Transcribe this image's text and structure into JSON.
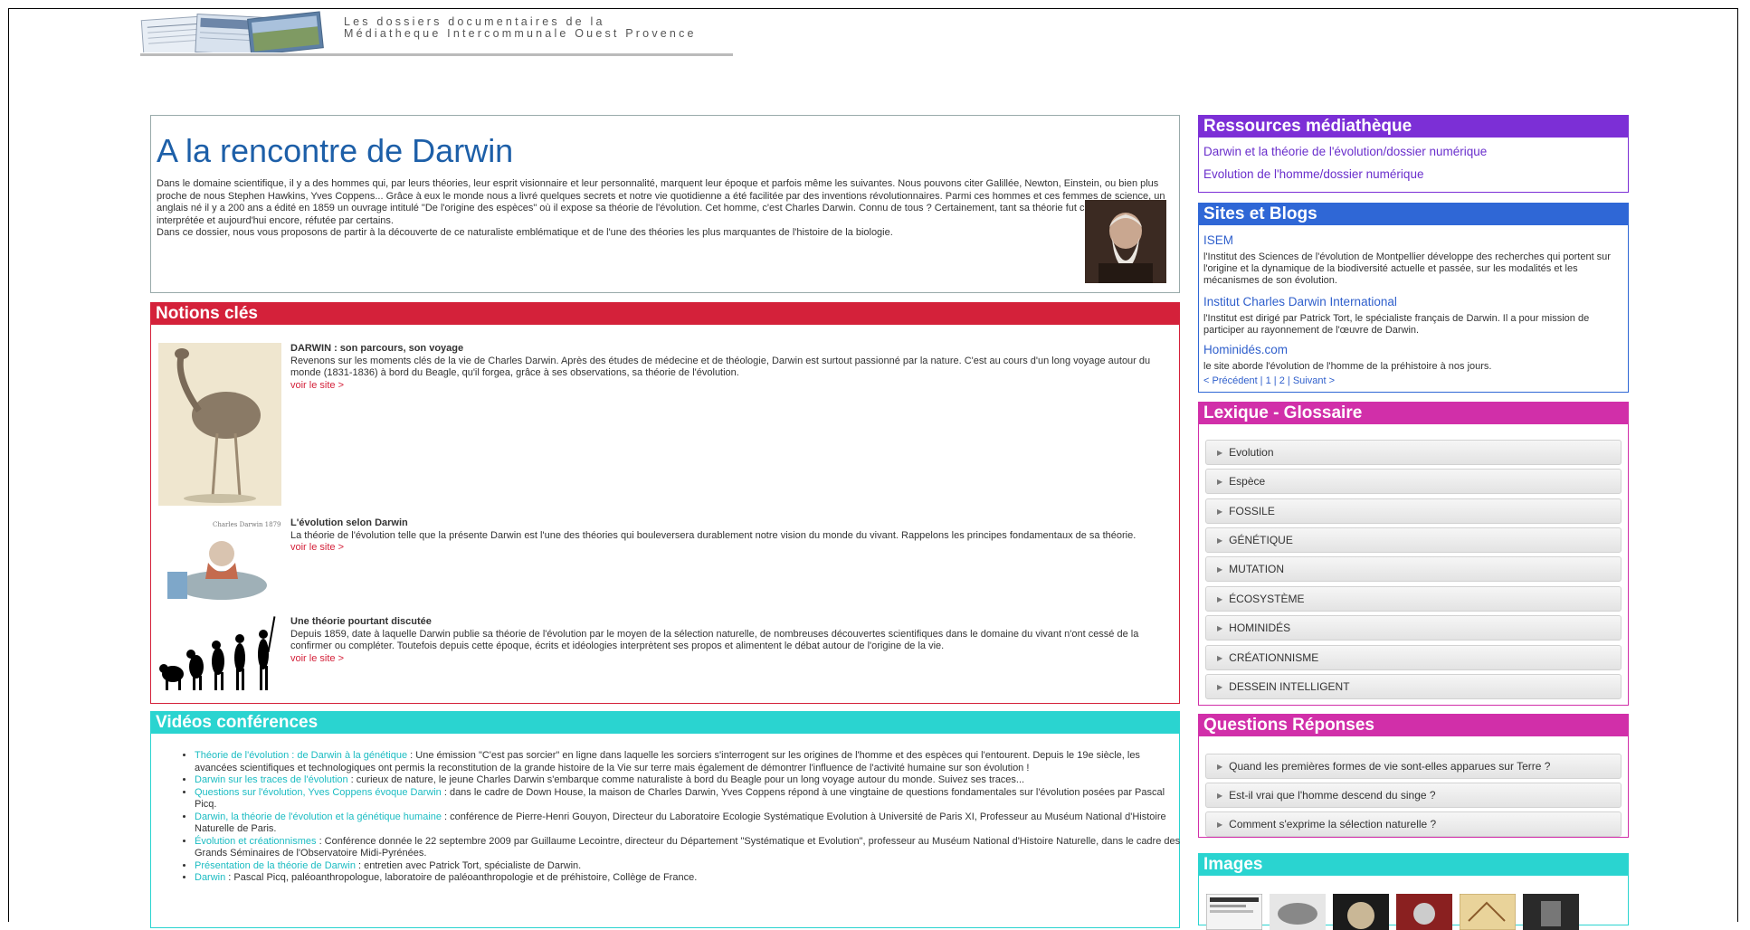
{
  "banner": {
    "line1": "Les dossiers documentaires de la",
    "line2": "Médiatheque Intercommunale Ouest Provence"
  },
  "intro": {
    "title": "A la rencontre de Darwin",
    "paragraph1": "Dans le domaine scientifique, il y a des hommes qui, par leurs théories, leur esprit visionnaire et leur personnalité, marquent leur époque et parfois même les suivantes. Nous pouvons citer Galillée, Newton, Einstein, ou bien plus proche de nous Stephen Hawkins, Yves Coppens... Grâce à eux le monde nous a livré quelques secrets et notre vie quotidienne a été facilitée par des inventions révolutionnaires. Parmi ces hommes et ces femmes de science, un anglais né il y a 200 ans a édité en 1859 un ouvrage intitulé \"De l'origine des espèces\" où il expose sa théorie de l'évolution. Cet homme, c'est Charles Darwin. Connu de tous ? Certainement, tant sa théorie fut controversée, interprétée et aujourd'hui encore, réfutée par certains.",
    "paragraph2": "Dans ce dossier, nous vous proposons de partir à la découverte de ce naturaliste emblématique et de l'une des théories les plus marquantes de l'histoire de la biologie."
  },
  "notions": {
    "title": "Notions clés",
    "more_label": "voir le site >",
    "items": [
      {
        "title": "DARWIN : son parcours, son voyage",
        "text": "Revenons sur les moments clés de la vie de Charles Darwin. Après des études de médecine et de théologie, Darwin est surtout passionné par la nature. C'est au cours d'un long voyage autour du monde (1831-1836) à bord du Beagle, qu'il forgea, grâce à ses observations, sa théorie de l'évolution."
      },
      {
        "title": "L'évolution selon Darwin",
        "text": "La théorie de l'évolution telle que la présente Darwin est l'une des théories qui bouleversera durablement notre vision du monde du vivant. Rappelons les principes fondamentaux de sa théorie.",
        "caption": "Charles Darwin 1879"
      },
      {
        "title": "Une théorie pourtant discutée",
        "text": "Depuis 1859, date à laquelle Darwin publie sa théorie de l'évolution par le moyen de la sélection naturelle, de nombreuses découvertes scientifiques dans le domaine du vivant n'ont cessé de la confirmer ou compléter. Toutefois depuis cette époque, écrits et idéologies interprètent ses propos et alimentent le débat autour de l'origine de la vie."
      }
    ]
  },
  "videos": {
    "title": "Vidéos conférences",
    "items": [
      {
        "link": "Théorie de l'évolution : de Darwin à la génétique",
        "text": " : Une émission \"C'est pas sorcier\" en ligne dans laquelle les sorciers s'interrogent sur les origines de l'homme et des espèces qui l'entourent. Depuis le 19e siècle, les avancées scientifiques et technologiques ont permis la reconstitution de la grande histoire de la Vie sur terre mais également de démontrer l'influence de l'activité humaine sur son évolution !"
      },
      {
        "link": "Darwin sur les traces de l'évolution",
        "text": " : curieux de nature, le jeune Charles Darwin s'embarque comme naturaliste à bord du Beagle pour un long voyage autour du monde. Suivez ses traces..."
      },
      {
        "link": "Questions sur l'évolution, Yves Coppens évoque Darwin",
        "text": " : dans le cadre de Down House, la maison de Charles Darwin, Yves Coppens répond à une vingtaine de questions fondamentales sur l'évolution posées par Pascal Picq."
      },
      {
        "link": "Darwin, la théorie de l'évolution et la génétique humaine",
        "text": " : conférence de Pierre-Henri Gouyon, Directeur du Laboratoire Ecologie Systématique Evolution à Université de Paris XI, Professeur au Muséum National d'Histoire Naturelle de Paris."
      },
      {
        "link": "Évolution et créationnismes",
        "text": " : Conférence donnée le 22 septembre 2009 par Guillaume Lecointre, directeur du Département \"Systématique et Evolution\", professeur au Muséum National d'Histoire Naturelle, dans le cadre des Grands Séminaires de l'Observatoire Midi-Pyrénées."
      },
      {
        "link": "Présentation de la théorie de Darwin",
        "text": " : entretien avec Patrick Tort, spécialiste de Darwin."
      },
      {
        "link": "Darwin",
        "text": " : Pascal Picq, paléoanthropologue, laboratoire de paléoanthropologie et de préhistoire, Collège de France."
      }
    ]
  },
  "ressources": {
    "title": "Ressources médiathèque",
    "links": [
      "Darwin et la théorie de l'évolution/dossier numérique",
      "Evolution de l'homme/dossier numérique"
    ]
  },
  "sites": {
    "title": "Sites et Blogs",
    "items": [
      {
        "name": "ISEM",
        "desc": "l'Institut des Sciences de l'évolution de Montpellier développe des recherches qui portent sur l'origine et la dynamique de la biodiversité actuelle et passée, sur les modalités et les mécanismes de son évolution."
      },
      {
        "name": "Institut Charles Darwin International",
        "desc": "l'Institut est dirigé par Patrick Tort, le spécialiste français de Darwin. Il a pour mission de participer au rayonnement de l'œuvre de Darwin."
      },
      {
        "name": "Hominidés.com",
        "desc": "le site aborde l'évolution de l'homme de la préhistoire à nos jours."
      }
    ],
    "pager": {
      "prev": "< Précédent",
      "sep1": " | ",
      "p1": "1",
      "sep2": " | ",
      "p2": "2",
      "sep3": " | ",
      "next": "Suivant >"
    }
  },
  "lexique": {
    "title": "Lexique - Glossaire",
    "items": [
      "Evolution",
      "Espèce",
      "FOSSILE",
      "GÉNÉTIQUE",
      "MUTATION",
      "ÉCOSYSTÈME",
      "HOMINIDÉS",
      "CRÉATIONNISME",
      "DESSEIN INTELLIGENT"
    ]
  },
  "questions": {
    "title": "Questions Réponses",
    "items": [
      "Quand les premières formes de vie sont-elles apparues sur Terre ?",
      "Est-il vrai que l'homme descend du singe ?",
      "Comment s'exprime la sélection naturelle ?"
    ]
  },
  "images": {
    "title": "Images"
  },
  "colors": {
    "notions": "#d4213a",
    "videos": "#2ad4d0",
    "ressources": "#7c2fd6",
    "sites": "#2f67d6",
    "lexique": "#d12fa9",
    "title": "#1d5fa8"
  }
}
